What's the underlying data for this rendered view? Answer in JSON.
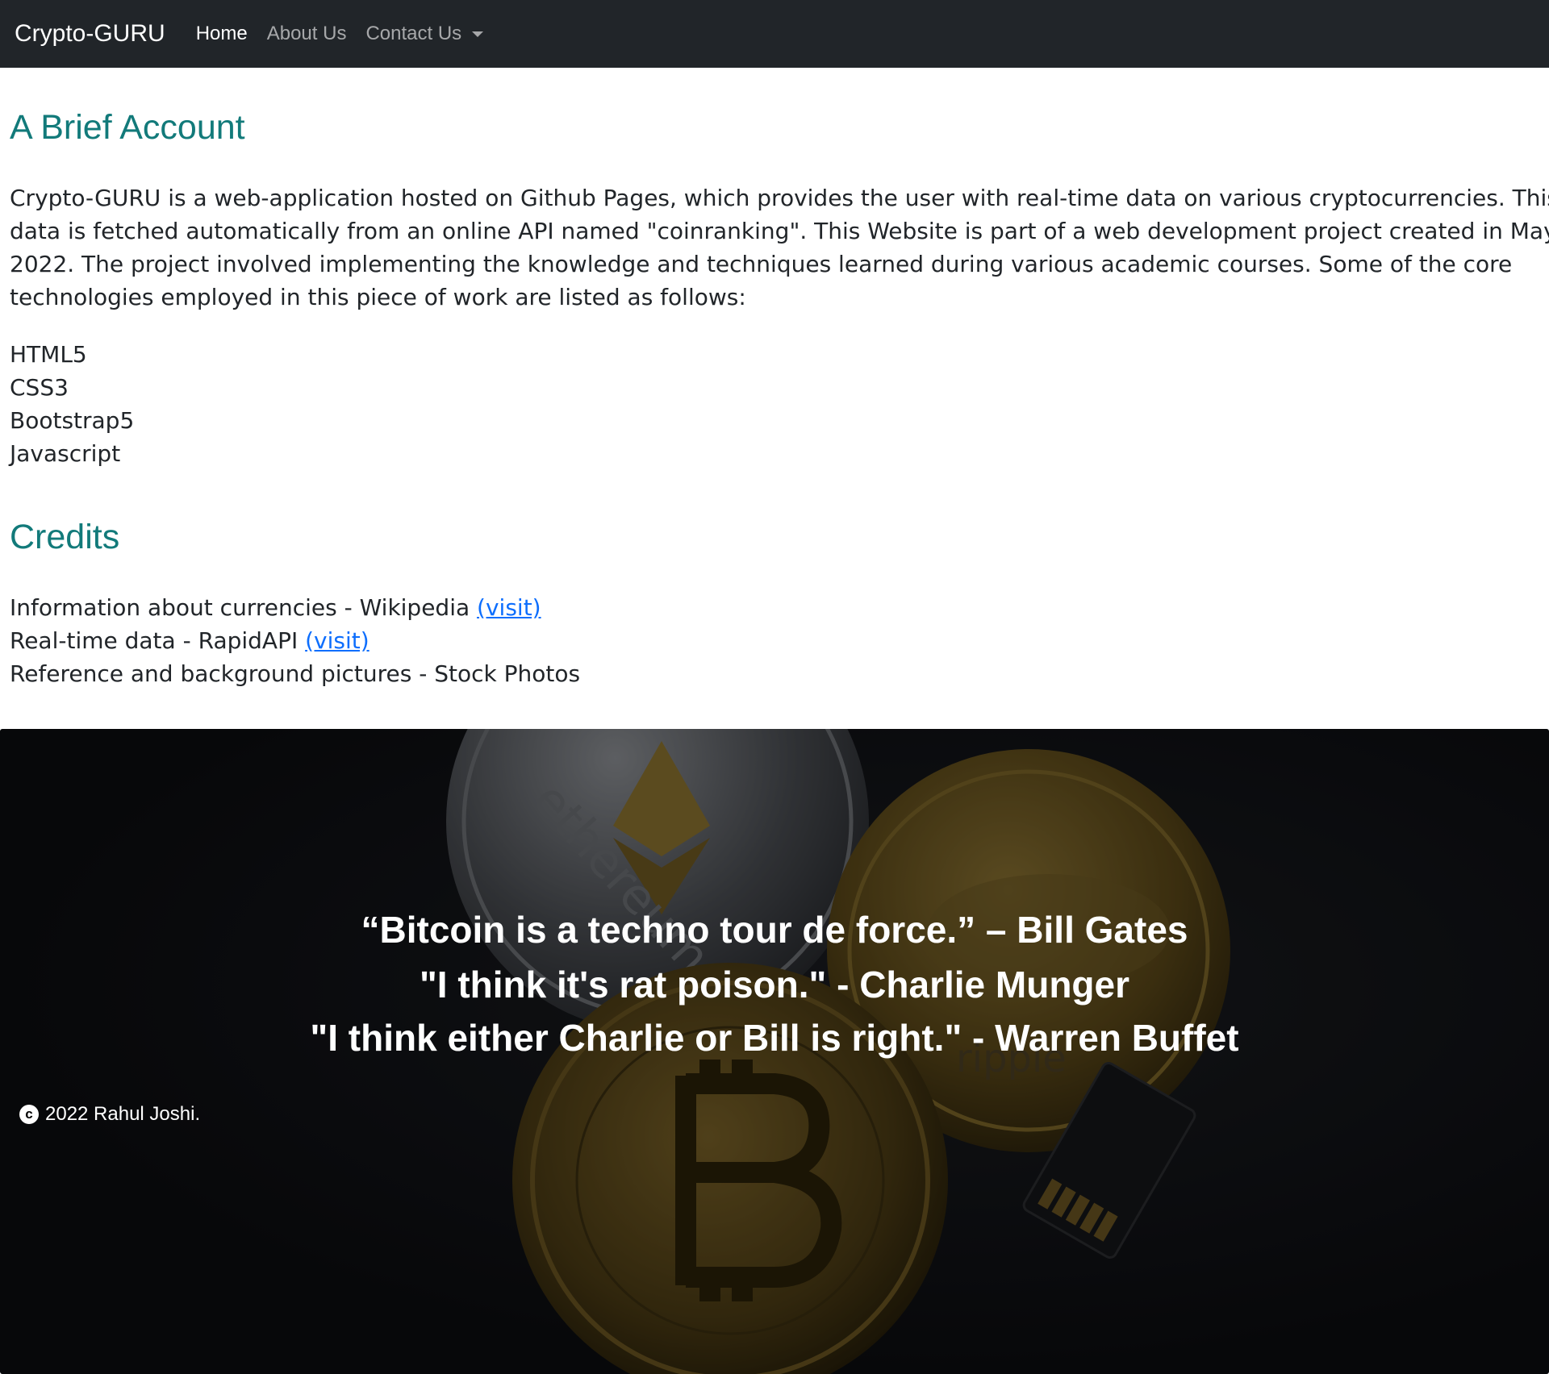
{
  "nav": {
    "brand": "Crypto-GURU",
    "links": [
      {
        "label": "Home"
      },
      {
        "label": "About Us"
      },
      {
        "label": "Contact Us"
      }
    ]
  },
  "account": {
    "heading": "A Brief Account",
    "intro_lines": [
      "Crypto-GURU is a web-application hosted on Github Pages, which provides the user with real-time data on various cryptocurrencies. This",
      "data is fetched automatically from an online API named \"coinranking\". This Website is part of a web development project created in May",
      "2022. The project involved implementing the knowledge and techniques learned during various academic courses. Some of the core",
      "technologies employed in this piece of work are listed as follows:"
    ],
    "technologies": [
      "HTML5",
      "CSS3",
      "Bootstrap5",
      "Javascript"
    ]
  },
  "credits": {
    "heading": "Credits",
    "items": [
      {
        "text": "Information about currencies - Wikipedia ",
        "link": "(visit)"
      },
      {
        "text": "Real-time data - RapidAPI ",
        "link": "(visit)"
      },
      {
        "text": "Reference and background pictures - Stock Photos"
      }
    ]
  },
  "banner": {
    "quotes": [
      "“Bitcoin is a techno tour de force.” – Bill Gates",
      "\"I think it's rat poison.\" - Charlie Munger",
      "\"I think either Charlie or Bill is right.\" - Warren Buffet"
    ],
    "copyright_symbol": "c",
    "copyright": "2022 Rahul Joshi.",
    "coin_labels": {
      "ethereum": "ethereum",
      "ripple": "ripple"
    }
  },
  "colors": {
    "navbar_bg": "#212529",
    "heading": "#127a7a",
    "link": "#0d6efd",
    "body_text": "#212529"
  }
}
